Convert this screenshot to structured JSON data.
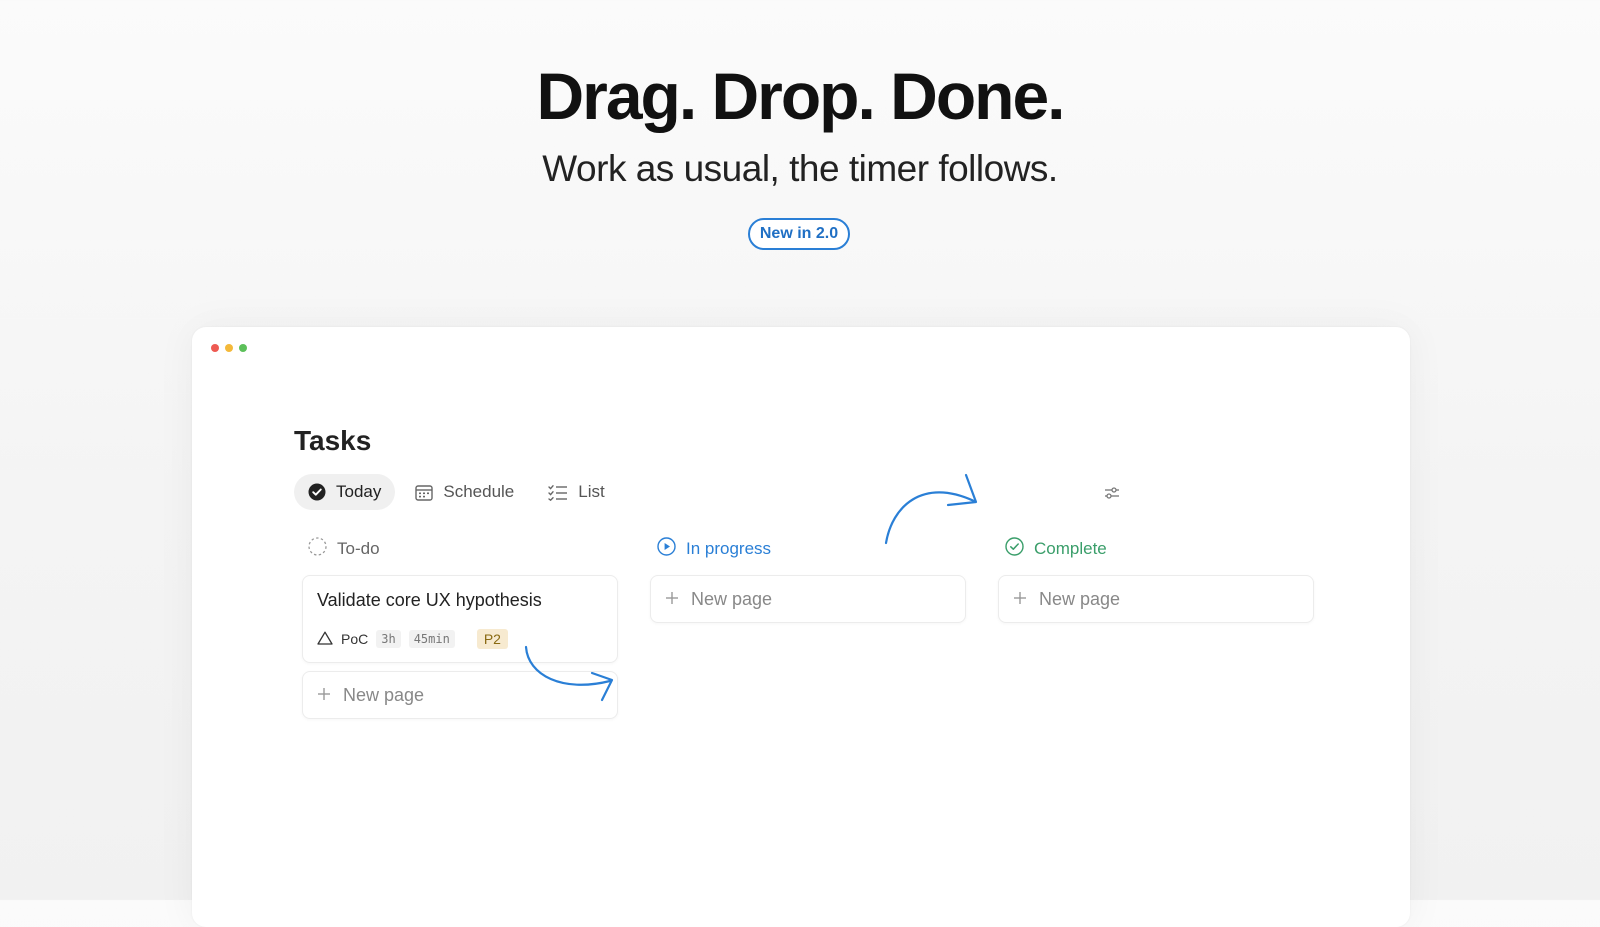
{
  "hero": {
    "title": "Drag. Drop. Done.",
    "subtitle": "Work as usual, the timer follows.",
    "badge": "New in 2.0"
  },
  "app": {
    "title": "Tasks",
    "tabs": [
      {
        "label": "Today",
        "icon": "check-circle-icon",
        "active": true
      },
      {
        "label": "Schedule",
        "icon": "calendar-icon",
        "active": false
      },
      {
        "label": "List",
        "icon": "checklist-icon",
        "active": false
      }
    ],
    "columns": [
      {
        "label": "To-do",
        "icon": "dashed-circle-icon",
        "color": "#666666"
      },
      {
        "label": "In progress",
        "icon": "play-circle-icon",
        "color": "#2a7fd6"
      },
      {
        "label": "Complete",
        "icon": "check-circle-outline-icon",
        "color": "#3a9e6a"
      }
    ],
    "task": {
      "title": "Validate core UX hypothesis",
      "project": "PoC",
      "estimate_hours": "3h",
      "estimate_minutes": "45min",
      "priority": "P2"
    },
    "new_page_label": "New page"
  },
  "colors": {
    "accent": "#2a7fd6",
    "complete": "#3a9e6a",
    "priority_bg": "#f7ead0"
  }
}
